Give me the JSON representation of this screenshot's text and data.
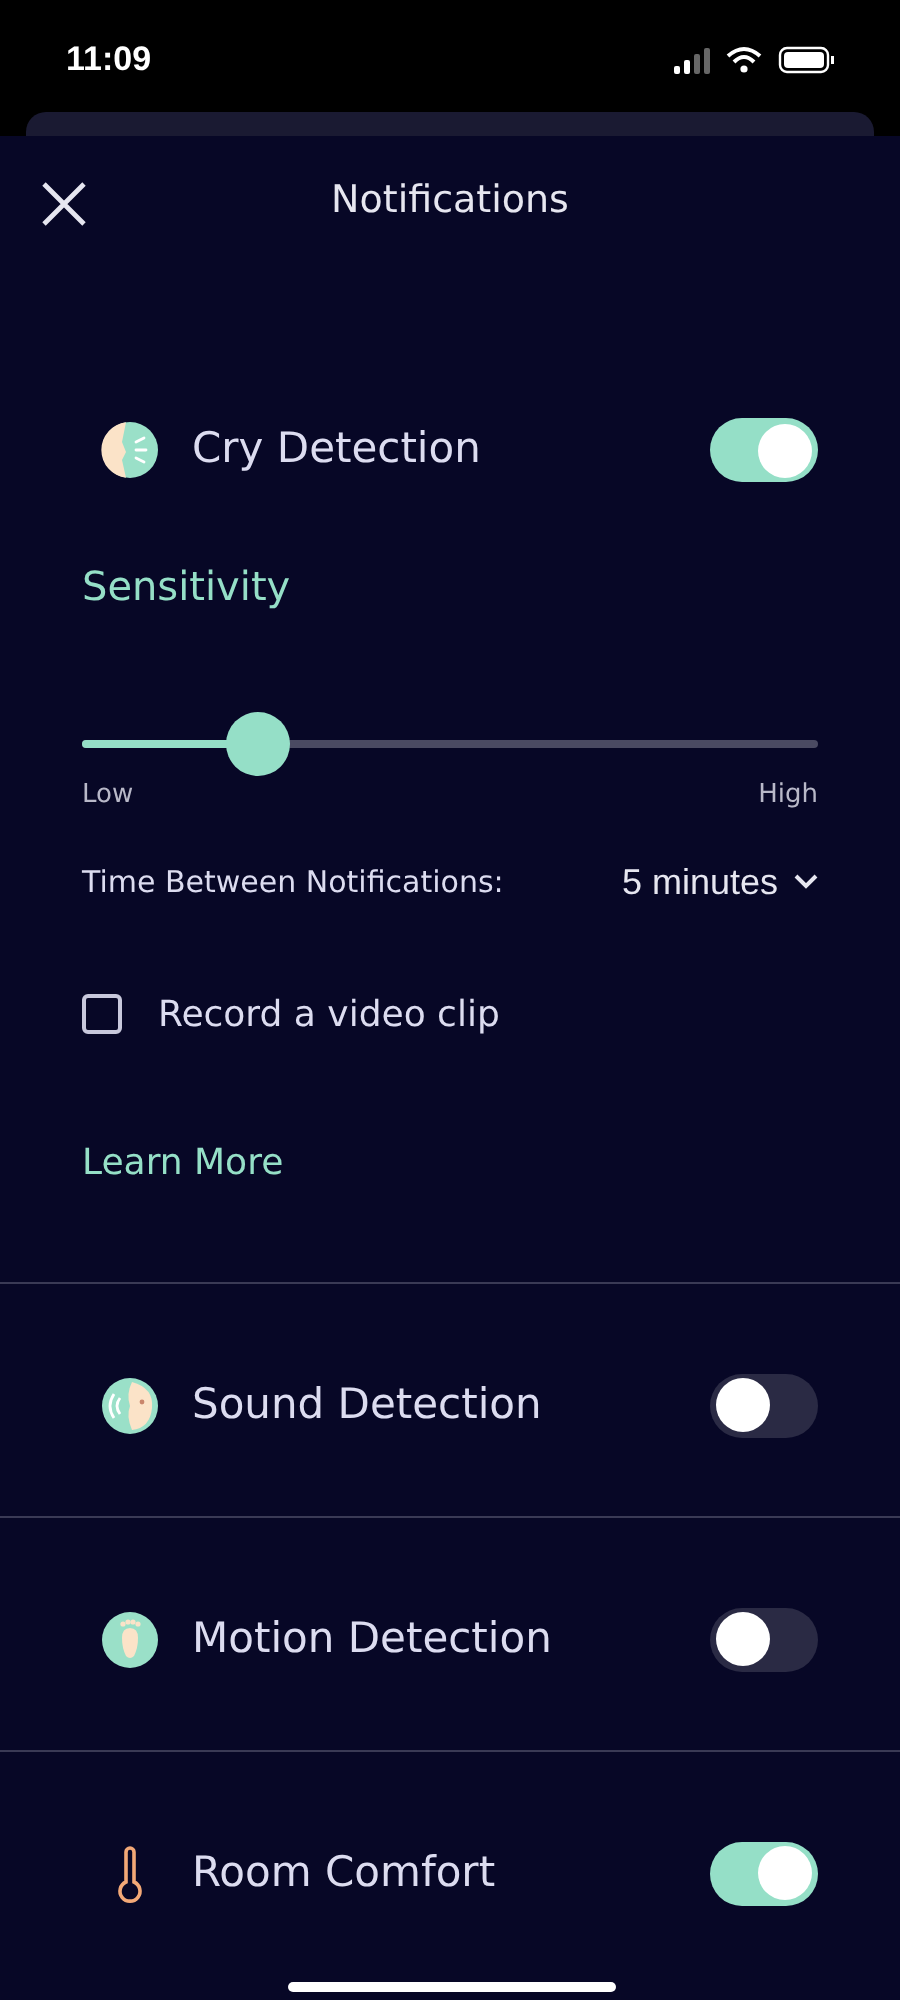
{
  "status_bar": {
    "time": "11:09"
  },
  "header": {
    "title": "Notifications"
  },
  "cry_section": {
    "kind": "cry",
    "label": "Cry Detection",
    "on": true,
    "sensitivity": {
      "title": "Sensitivity",
      "level": 0.24,
      "low": "Low",
      "high": "High"
    },
    "interval": {
      "label": "Time Between Notifications:",
      "value": "5 minutes"
    },
    "record_clip": {
      "label": "Record a video clip",
      "checked": false
    },
    "learn_more": "Learn More"
  },
  "sections": [
    {
      "kind": "sound",
      "label": "Sound Detection",
      "on": false
    },
    {
      "kind": "motion",
      "label": "Motion Detection",
      "on": false
    },
    {
      "kind": "temperature",
      "label": "Room Comfort",
      "on": true
    }
  ]
}
